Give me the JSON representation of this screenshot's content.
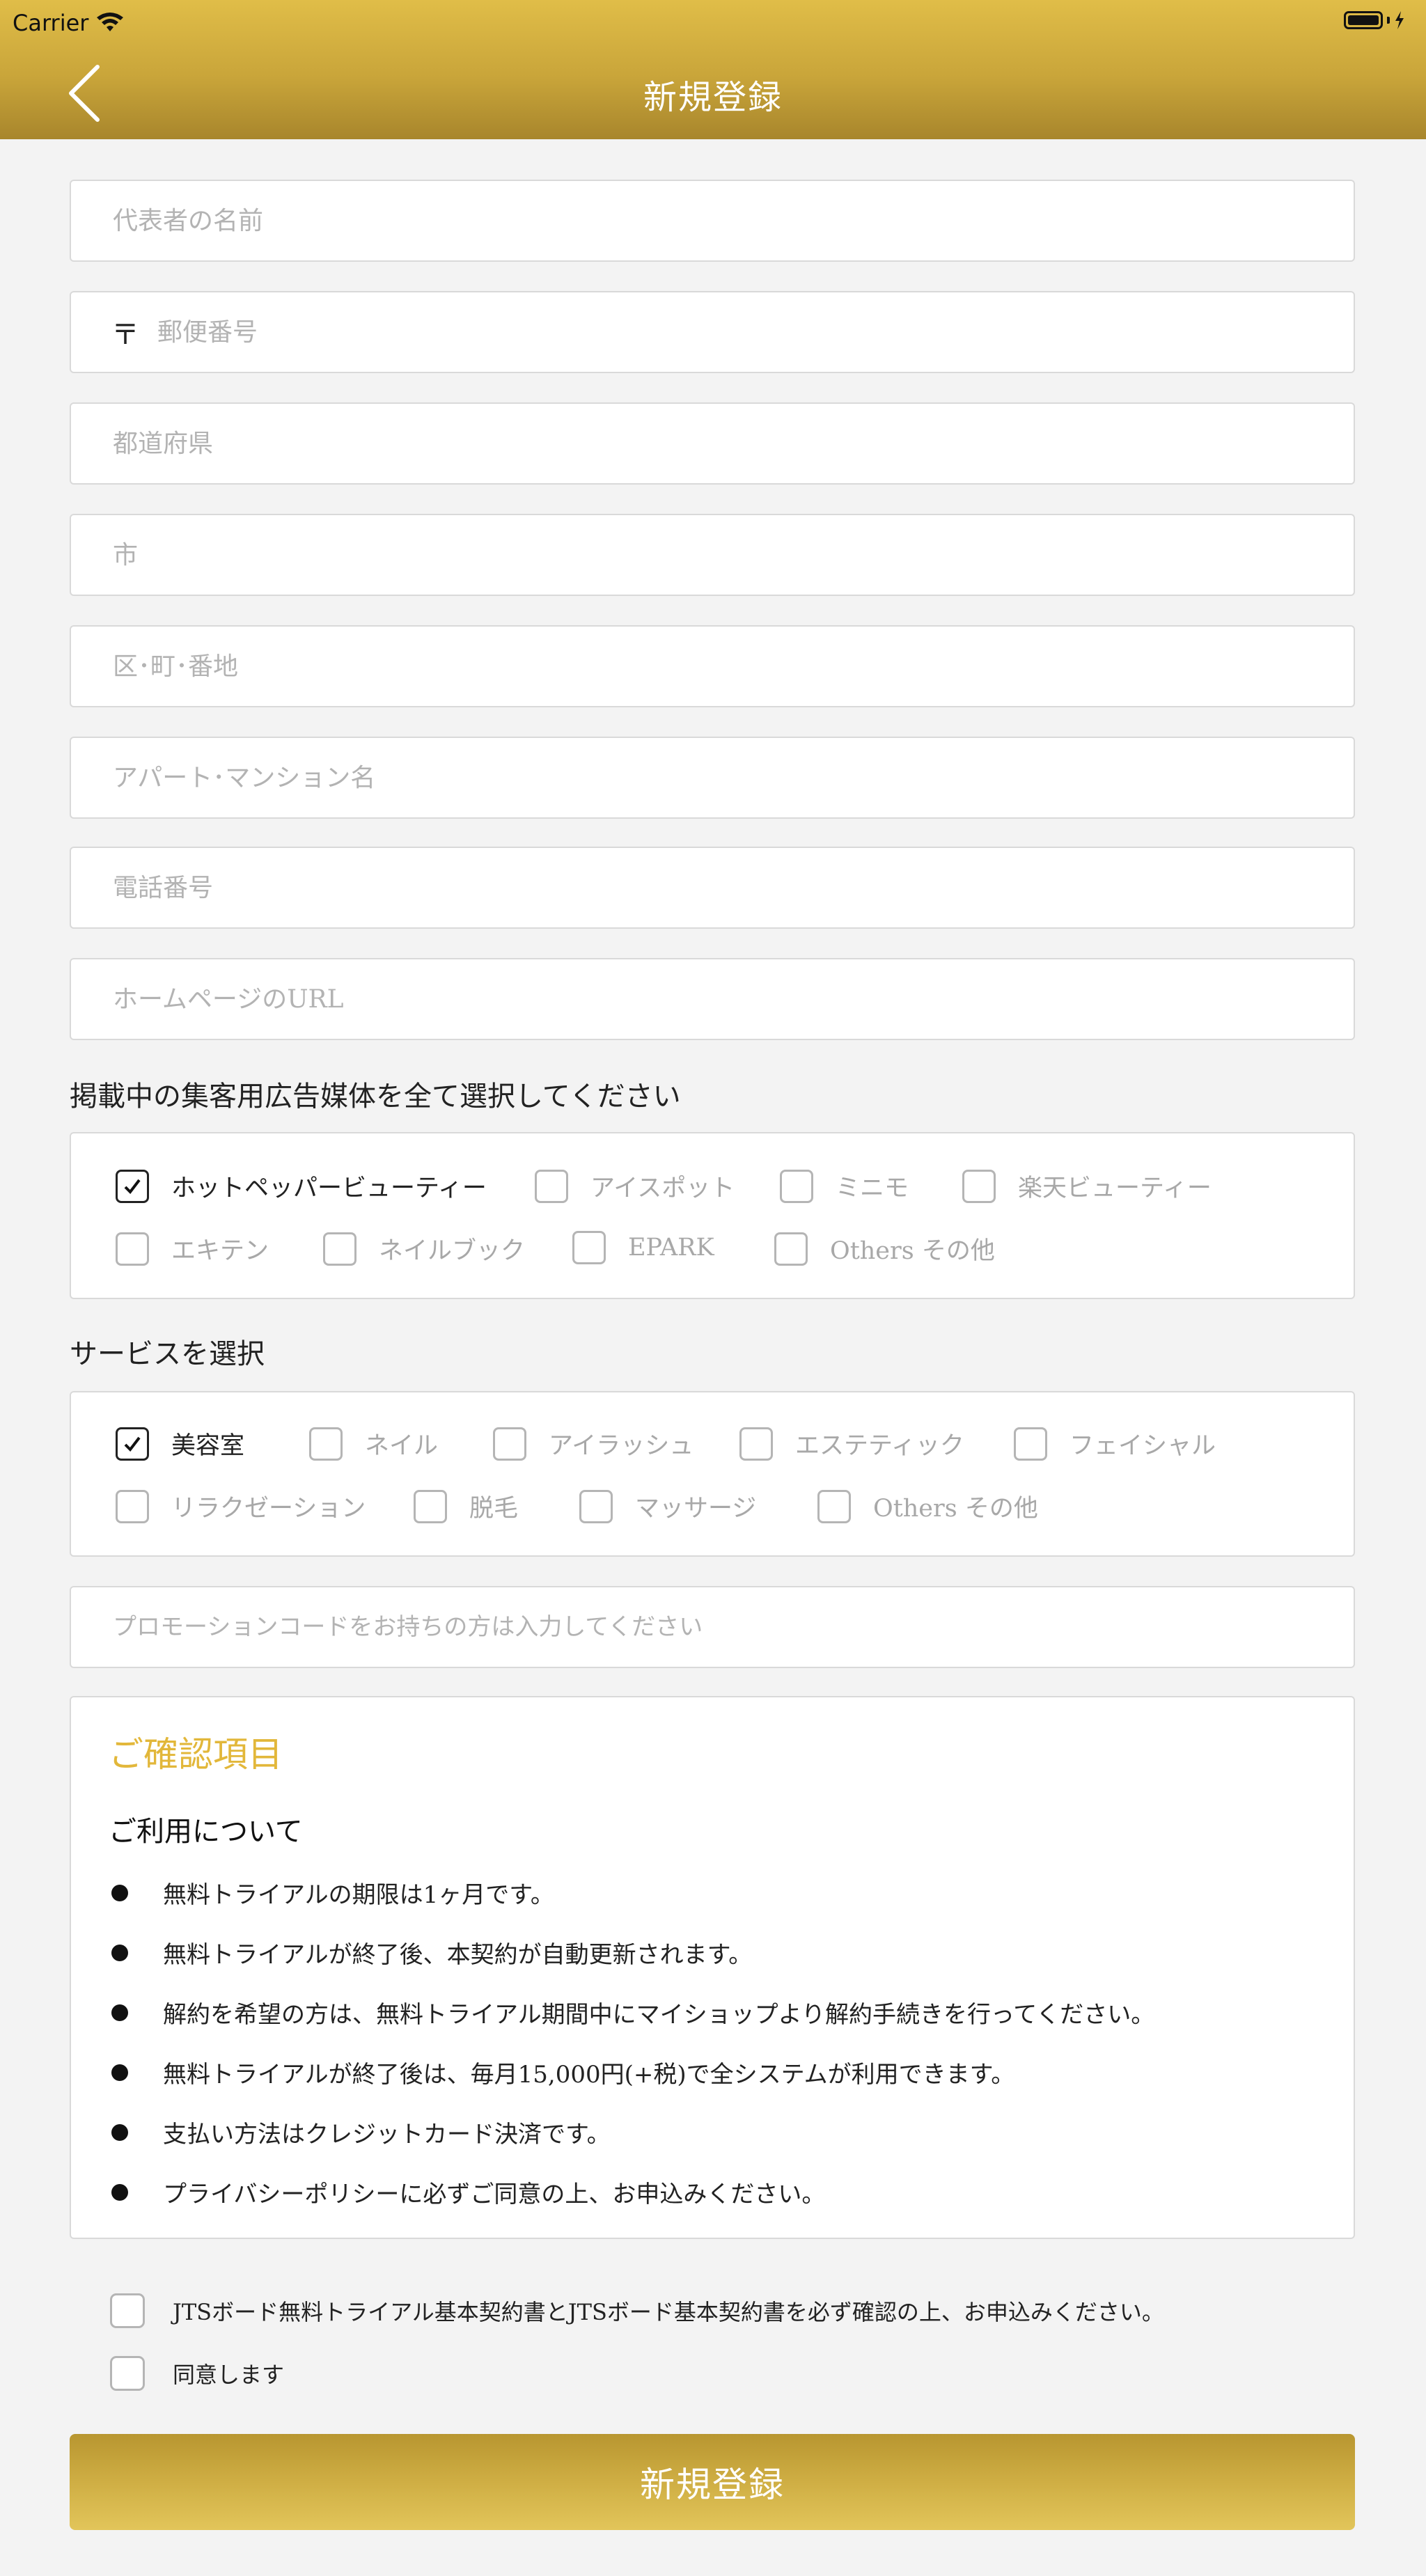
{
  "status_bar": {
    "carrier": "Carrier"
  },
  "header": {
    "title": "新規登録",
    "back_icon": "chevron-left-icon"
  },
  "form": {
    "representative_name": {
      "placeholder": "代表者の名前",
      "value": ""
    },
    "postal_code": {
      "icon": "〒",
      "placeholder": "郵便番号",
      "value": ""
    },
    "prefecture": {
      "placeholder": "都道府県",
      "value": ""
    },
    "city": {
      "placeholder": "市",
      "value": ""
    },
    "ward_town_address": {
      "placeholder": "区･町･番地",
      "value": ""
    },
    "apartment": {
      "placeholder": "アパート･マンション名",
      "value": ""
    },
    "phone": {
      "placeholder": "電話番号",
      "value": ""
    },
    "homepage_url": {
      "placeholder": "ホームページのURL",
      "value": ""
    },
    "promo_code": {
      "placeholder": "プロモーションコードをお持ちの方は入力してください",
      "value": ""
    }
  },
  "media_section": {
    "label": "掲載中の集客用広告媒体を全て選択してください",
    "options": [
      {
        "label": "ホットペッパービューティー",
        "checked": true
      },
      {
        "label": "アイスポット",
        "checked": false
      },
      {
        "label": "ミニモ",
        "checked": false
      },
      {
        "label": "楽天ビューティー",
        "checked": false
      },
      {
        "label": "エキテン",
        "checked": false
      },
      {
        "label": "ネイルブック",
        "checked": false
      },
      {
        "label": "EPARK",
        "checked": false
      },
      {
        "label": "Others その他",
        "checked": false
      }
    ]
  },
  "service_section": {
    "label": "サービスを選択",
    "options": [
      {
        "label": "美容室",
        "checked": true
      },
      {
        "label": "ネイル",
        "checked": false
      },
      {
        "label": "アイラッシュ",
        "checked": false
      },
      {
        "label": "エステティック",
        "checked": false
      },
      {
        "label": "フェイシャル",
        "checked": false
      },
      {
        "label": "リラクゼーション",
        "checked": false
      },
      {
        "label": "脱毛",
        "checked": false
      },
      {
        "label": "マッサージ",
        "checked": false
      },
      {
        "label": "Others その他",
        "checked": false
      }
    ]
  },
  "confirmation": {
    "title": "ご確認項目",
    "subtitle": "ご利用について",
    "items": [
      "無料トライアルの期限は1ヶ月です。",
      "無料トライアルが終了後、本契約が自動更新されます。",
      "解約を希望の方は、無料トライアル期間中にマイショップより解約手続きを行ってください。",
      "無料トライアルが終了後は、毎月15,000円(+税)で全システムが利用できます。",
      "支払い方法はクレジットカード決済です。",
      "プライバシーポリシーに必ずご同意の上、お申込みください。"
    ]
  },
  "agreements": [
    {
      "label": "JTSボード無料トライアル基本契約書とJTSボード基本契約書を必ず確認の上、お申込みください。",
      "checked": false
    },
    {
      "label": "同意します",
      "checked": false
    }
  ],
  "submit_label": "新規登録",
  "colors": {
    "gold": "#c9a53a",
    "accent_title": "#e2b73a"
  }
}
